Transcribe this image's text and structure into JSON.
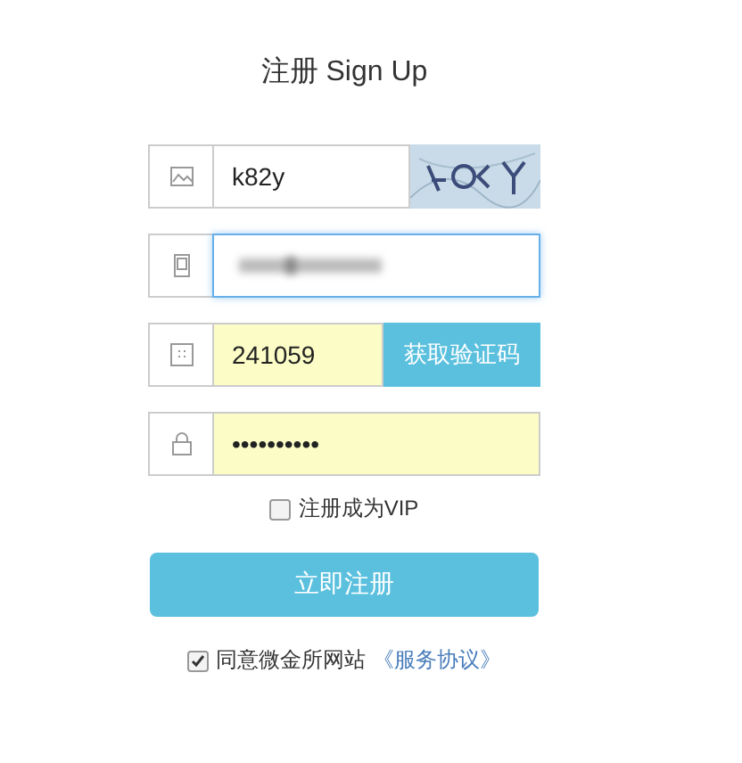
{
  "title": "注册 Sign Up",
  "fields": [
    {
      "kind": "captcha",
      "value": "k82y",
      "focused": false,
      "autofilled": false
    },
    {
      "kind": "phone",
      "obscured": true,
      "focused": true,
      "autofilled": false
    },
    {
      "kind": "code",
      "value": "241059",
      "focused": false,
      "autofilled": true,
      "button": "获取验证码"
    },
    {
      "kind": "password",
      "value": "••••••••••",
      "focused": false,
      "autofilled": true
    }
  ],
  "vip": {
    "label": "注册成为VIP",
    "checked": false
  },
  "submit": "立即注册",
  "agree": {
    "label": "同意微金所网站",
    "link": "《服务协议》",
    "checked": true
  }
}
